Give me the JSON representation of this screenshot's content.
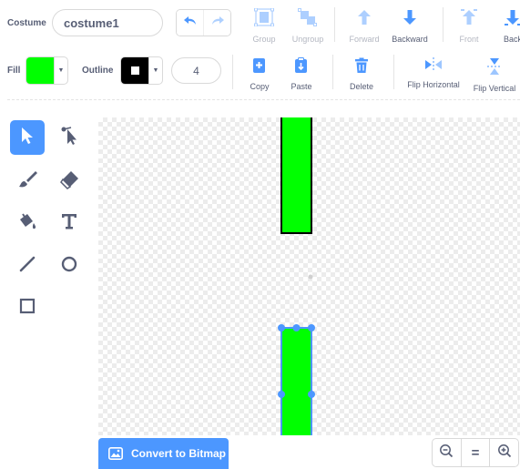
{
  "costume": {
    "label": "Costume",
    "name_value": "costume1"
  },
  "toolbar": {
    "group": "Group",
    "ungroup": "Ungroup",
    "forward": "Forward",
    "backward": "Backward",
    "front": "Front",
    "back": "Back",
    "copy": "Copy",
    "paste": "Paste",
    "delete": "Delete",
    "flip_horizontal": "Flip Horizontal",
    "flip_vertical": "Flip Vertical"
  },
  "fill": {
    "label": "Fill",
    "color": "#00ff00"
  },
  "outline": {
    "label": "Outline",
    "color": "#000000",
    "width": "4"
  },
  "tools": [
    "select-icon",
    "reshape-icon",
    "brush-icon",
    "eraser-icon",
    "fill-icon",
    "text-icon",
    "line-icon",
    "circle-icon",
    "rectangle-icon"
  ],
  "canvas": {
    "shape_fill": "#00ff00",
    "shape_stroke": "#000000",
    "selection_color": "#4c97ff"
  },
  "footer": {
    "convert_label": "Convert to Bitmap",
    "zoom_reset_label": "="
  },
  "colors": {
    "accent": "#4c97ff",
    "text": "#575e75",
    "border": "#d9d9d9"
  }
}
